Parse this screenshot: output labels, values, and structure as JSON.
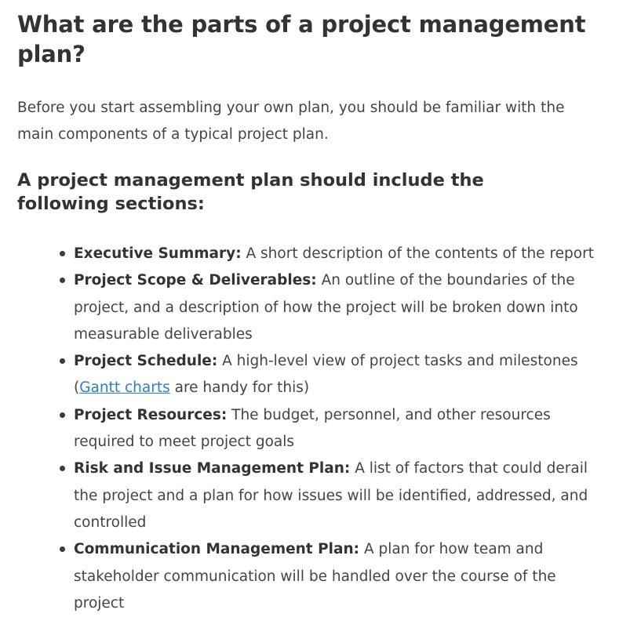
{
  "article": {
    "title": "What are the parts of a project management plan?",
    "intro": "Before you start assembling your own plan, you should be familiar with the main components of a typical project plan.",
    "subhead": "A project management plan should include the following sections:",
    "items": [
      {
        "term": "Executive Summary:",
        "desc": " A short description of the contents of the report"
      },
      {
        "term": "Project Scope & Deliverables:",
        "desc": " An outline of the boundaries of the project, and a description of how the project will be broken down into measurable deliverables"
      },
      {
        "term": "Project Schedule:",
        "desc_before": " A high-level view of project tasks and milestones (",
        "link": "Gantt charts",
        "desc_after": " are handy for this)"
      },
      {
        "term": "Project Resources:",
        "desc": " The budget, personnel, and other resources required to meet project goals"
      },
      {
        "term": "Risk and Issue Management Plan:",
        "desc": " A list of factors that could derail the project and a plan for how issues will be identified, addressed, and controlled"
      },
      {
        "term": "Communication Management Plan:",
        "desc": " A plan for how team and stakeholder communication will be handled over the course of the project"
      }
    ]
  },
  "colors": {
    "text": "#444444",
    "heading": "#333333",
    "link": "#2d7fc1"
  }
}
